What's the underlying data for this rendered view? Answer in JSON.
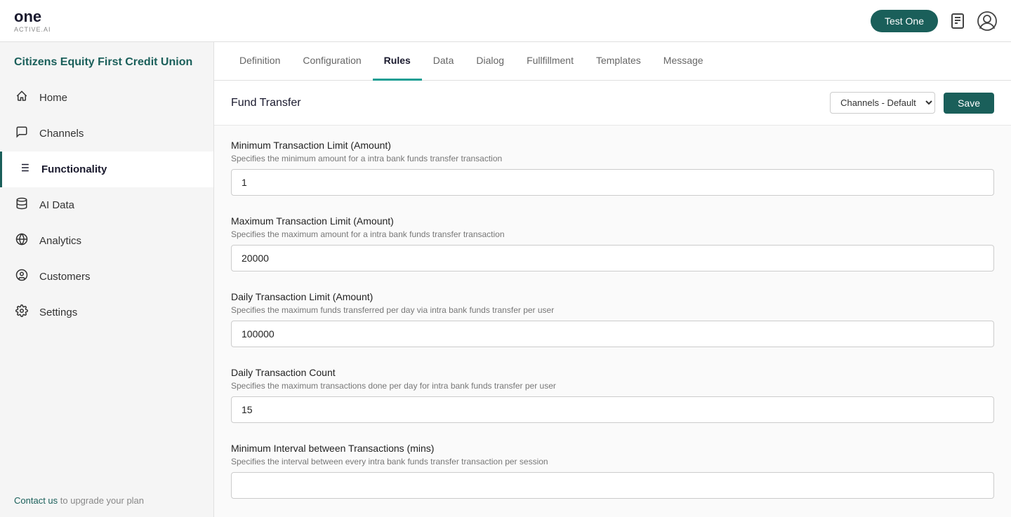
{
  "app": {
    "logo_main": "one",
    "logo_sub": "ACTIVE.AI",
    "test_btn": "Test One"
  },
  "org": {
    "name": "Citizens Equity First Credit Union"
  },
  "nav": {
    "items": [
      {
        "id": "home",
        "label": "Home",
        "icon": "⌂"
      },
      {
        "id": "channels",
        "label": "Channels",
        "icon": "💬"
      },
      {
        "id": "functionality",
        "label": "Functionality",
        "icon": "⇄",
        "active": true
      },
      {
        "id": "ai-data",
        "label": "AI Data",
        "icon": "🗄"
      },
      {
        "id": "analytics",
        "label": "Analytics",
        "icon": "🌐"
      },
      {
        "id": "customers",
        "label": "Customers",
        "icon": "😊"
      },
      {
        "id": "settings",
        "label": "Settings",
        "icon": "⚙"
      }
    ]
  },
  "footer": {
    "prefix": "",
    "link_text": "Contact us",
    "suffix": " to upgrade your plan"
  },
  "tabs": [
    {
      "id": "definition",
      "label": "Definition"
    },
    {
      "id": "configuration",
      "label": "Configuration"
    },
    {
      "id": "rules",
      "label": "Rules",
      "active": true
    },
    {
      "id": "data",
      "label": "Data"
    },
    {
      "id": "dialog",
      "label": "Dialog"
    },
    {
      "id": "fulfillment",
      "label": "Fullfillment"
    },
    {
      "id": "templates",
      "label": "Templates"
    },
    {
      "id": "message",
      "label": "Message"
    }
  ],
  "page": {
    "title": "Fund Transfer",
    "channel_select": "Channels - Default",
    "save_btn": "Save"
  },
  "fields": [
    {
      "id": "min-transaction-limit",
      "label": "Minimum Transaction Limit (Amount)",
      "desc": "Specifies the minimum amount for a intra bank funds transfer transaction",
      "value": "1"
    },
    {
      "id": "max-transaction-limit",
      "label": "Maximum Transaction Limit (Amount)",
      "desc": "Specifies the maximum amount for a intra bank funds transfer transaction",
      "value": "20000"
    },
    {
      "id": "daily-transaction-limit",
      "label": "Daily Transaction Limit (Amount)",
      "desc": "Specifies the maximum funds transferred per day via intra bank funds transfer per user",
      "value": "100000"
    },
    {
      "id": "daily-transaction-count",
      "label": "Daily Transaction Count",
      "desc": "Specifies the maximum transactions done per day for intra bank funds transfer per user",
      "value": "15"
    },
    {
      "id": "min-interval",
      "label": "Minimum Interval between Transactions (mins)",
      "desc": "Specifies the interval between every intra bank funds transfer transaction per session",
      "value": ""
    }
  ]
}
